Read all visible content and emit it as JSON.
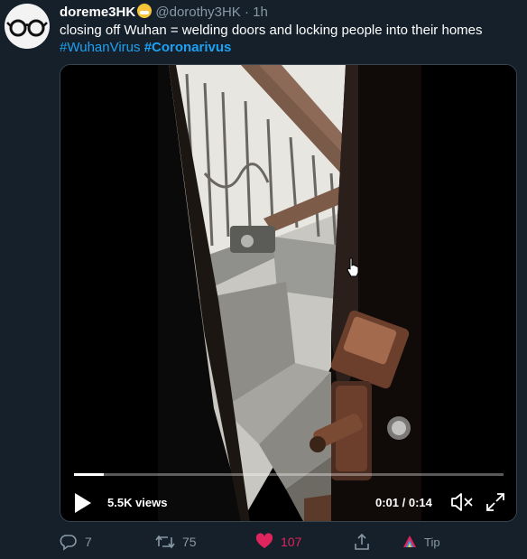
{
  "tweet": {
    "author_name": "doreme3HK",
    "handle": "@dorothy3HK",
    "separator": "·",
    "time_ago": "1h",
    "text": "closing off Wuhan = welding doors and locking people into their homes",
    "hashtags": [
      "#WuhanVirus",
      "#Coronarivus"
    ]
  },
  "video": {
    "views": "5.5K views",
    "time": "0:01 / 0:14",
    "progress_fraction": 0.07
  },
  "actions": {
    "reply_count": "7",
    "retweet_count": "75",
    "like_count": "107",
    "tip_label": "Tip"
  },
  "icons": [
    "glasses-avatar",
    "mask-emoji",
    "play-icon",
    "mute-icon",
    "fullscreen-icon",
    "reply-icon",
    "retweet-icon",
    "heart-icon",
    "share-icon",
    "tip-icon",
    "cursor-icon"
  ],
  "colors": {
    "background": "#15202b",
    "secondary_text": "#8899a6",
    "link": "#1da1f2",
    "like": "#e0245e"
  }
}
